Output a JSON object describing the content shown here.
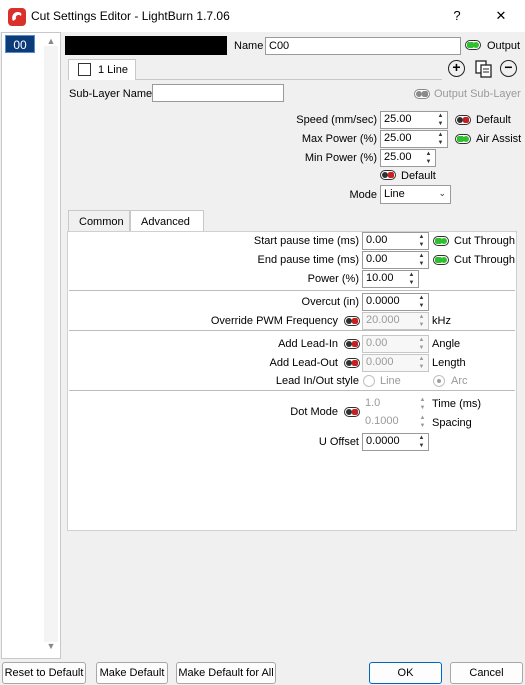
{
  "window": {
    "title": "Cut Settings Editor - LightBurn 1.7.06",
    "help_label": "?",
    "close_label": "✕"
  },
  "layers": [
    "00"
  ],
  "header": {
    "name_label": "Name",
    "name_value": "C00",
    "output_label": "Output",
    "swatch_color": "#000000"
  },
  "sublayer": {
    "tab_label": "1 Line",
    "name_label": "Sub-Layer Name",
    "name_value": "",
    "output_sublayer_label": "Output Sub-Layer"
  },
  "params": {
    "speed_label": "Speed (mm/sec)",
    "speed_value": "25.00",
    "default_label": "Default",
    "max_power_label": "Max Power (%)",
    "max_power_value": "25.00",
    "air_assist_label": "Air Assist",
    "min_power_label": "Min Power (%)",
    "min_power_value": "25.00",
    "default2_label": "Default",
    "mode_label": "Mode",
    "mode_value": "Line"
  },
  "tabs": {
    "common": "Common",
    "advanced": "Advanced"
  },
  "advanced": {
    "start_pause_label": "Start pause time (ms)",
    "start_pause_value": "0.00",
    "cut_through_label": "Cut Through",
    "end_pause_label": "End pause time (ms)",
    "end_pause_value": "0.00",
    "cut_through2_label": "Cut Through",
    "power_label": "Power (%)",
    "power_value": "10.00",
    "overcut_label": "Overcut (in)",
    "overcut_value": "0.0000",
    "override_pwm_label": "Override PWM Frequency",
    "pwm_value": "20.000",
    "khz_label": "kHz",
    "lead_in_label": "Add Lead-In",
    "lead_in_value": "0.00",
    "angle_label": "Angle",
    "lead_out_label": "Add Lead-Out",
    "lead_out_value": "0.000",
    "length_label": "Length",
    "leadstyle_label": "Lead In/Out style",
    "line_option": "Line",
    "arc_option": "Arc",
    "dot_mode_label": "Dot Mode",
    "dot_time_value": "1.0",
    "time_label": "Time (ms)",
    "dot_spacing_value": "0.1000",
    "spacing_label": "Spacing",
    "u_offset_label": "U Offset",
    "u_offset_value": "0.0000"
  },
  "footer": {
    "reset_label": "Reset to Default",
    "make_default_label": "Make Default",
    "make_default_all_label": "Make Default for All",
    "ok_label": "OK",
    "cancel_label": "Cancel"
  }
}
